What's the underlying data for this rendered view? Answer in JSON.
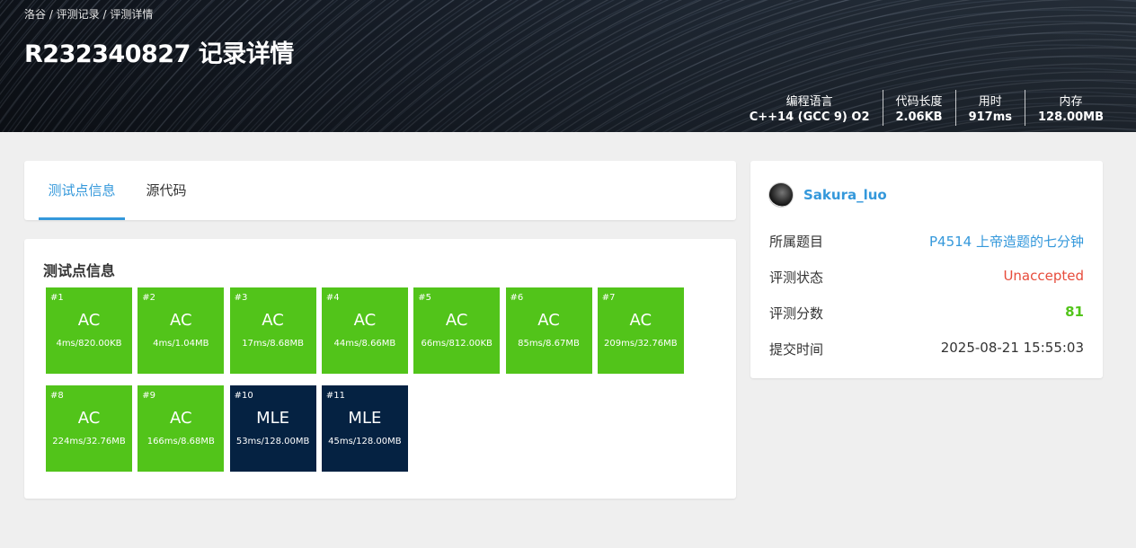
{
  "header": {
    "breadcrumb": "洛谷 / 评测记录 / 评测详情",
    "title": "R232340827 记录详情",
    "stats": [
      {
        "label": "编程语言",
        "value": "C++14 (GCC 9) O2"
      },
      {
        "label": "代码长度",
        "value": "2.06KB"
      },
      {
        "label": "用时",
        "value": "917ms"
      },
      {
        "label": "内存",
        "value": "128.00MB"
      }
    ]
  },
  "tabs": [
    {
      "label": "测试点信息",
      "active": true
    },
    {
      "label": "源代码",
      "active": false
    }
  ],
  "tests": {
    "section_title": "测试点信息",
    "cases": [
      {
        "num": "#1",
        "status": "AC",
        "detail": "4ms/820.00KB"
      },
      {
        "num": "#2",
        "status": "AC",
        "detail": "4ms/1.04MB"
      },
      {
        "num": "#3",
        "status": "AC",
        "detail": "17ms/8.68MB"
      },
      {
        "num": "#4",
        "status": "AC",
        "detail": "44ms/8.66MB"
      },
      {
        "num": "#5",
        "status": "AC",
        "detail": "66ms/812.00KB"
      },
      {
        "num": "#6",
        "status": "AC",
        "detail": "85ms/8.67MB"
      },
      {
        "num": "#7",
        "status": "AC",
        "detail": "209ms/32.76MB"
      },
      {
        "num": "#8",
        "status": "AC",
        "detail": "224ms/32.76MB"
      },
      {
        "num": "#9",
        "status": "AC",
        "detail": "166ms/8.68MB"
      },
      {
        "num": "#10",
        "status": "MLE",
        "detail": "53ms/128.00MB"
      },
      {
        "num": "#11",
        "status": "MLE",
        "detail": "45ms/128.00MB"
      }
    ]
  },
  "info": {
    "username": "Sakura_luo",
    "rows": [
      {
        "label": "所属题目",
        "value": "P4514 上帝造题的七分钟"
      },
      {
        "label": "评测状态",
        "value": "Unaccepted"
      },
      {
        "label": "评测分数",
        "value": "81"
      },
      {
        "label": "提交时间",
        "value": "2025-08-21 15:55:03"
      }
    ]
  },
  "colors": {
    "accent": "#3498db",
    "ac": "#52c41a",
    "mle": "#052242",
    "unaccepted": "#e74c3c"
  }
}
